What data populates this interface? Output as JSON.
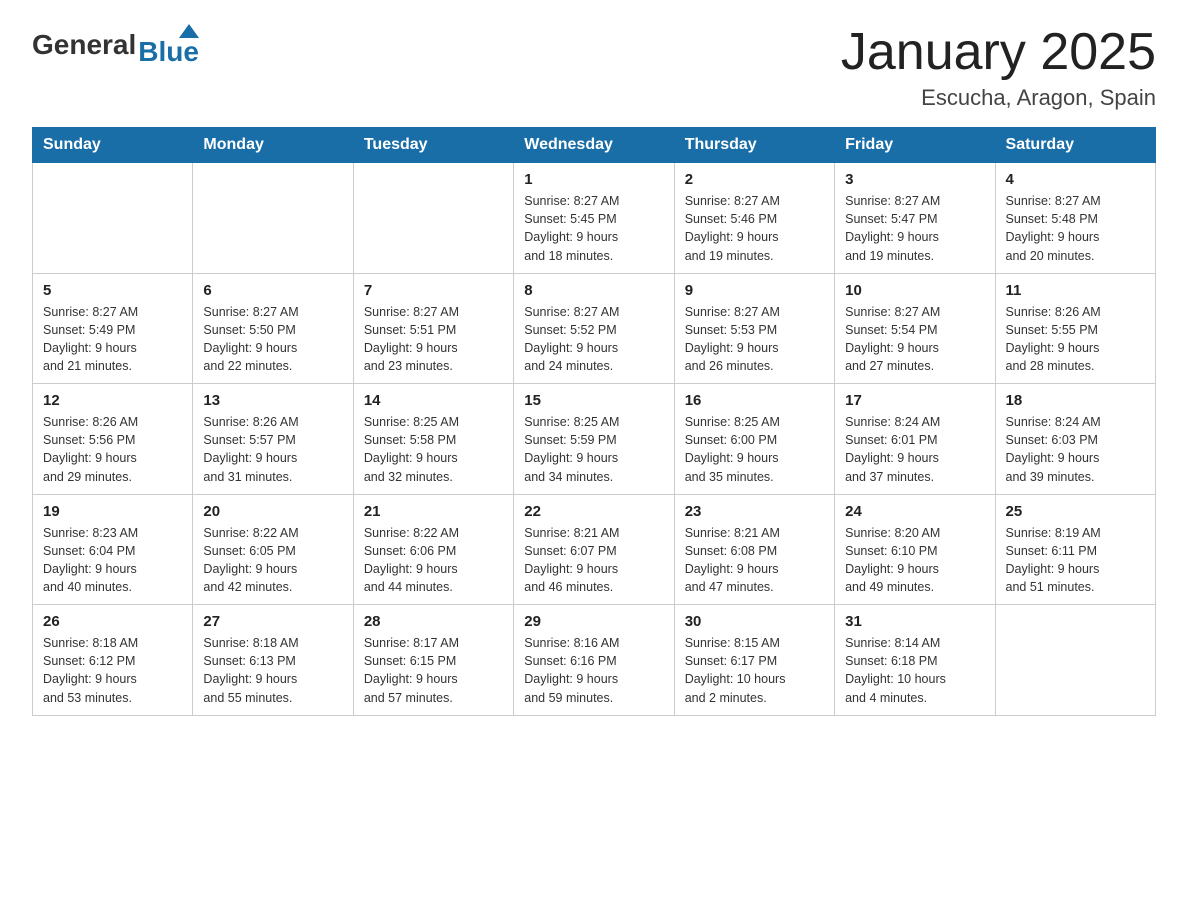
{
  "header": {
    "logo_general": "General",
    "logo_blue": "Blue",
    "month_title": "January 2025",
    "location": "Escucha, Aragon, Spain"
  },
  "days_of_week": [
    "Sunday",
    "Monday",
    "Tuesday",
    "Wednesday",
    "Thursday",
    "Friday",
    "Saturday"
  ],
  "weeks": [
    [
      {
        "day": "",
        "info": ""
      },
      {
        "day": "",
        "info": ""
      },
      {
        "day": "",
        "info": ""
      },
      {
        "day": "1",
        "info": "Sunrise: 8:27 AM\nSunset: 5:45 PM\nDaylight: 9 hours\nand 18 minutes."
      },
      {
        "day": "2",
        "info": "Sunrise: 8:27 AM\nSunset: 5:46 PM\nDaylight: 9 hours\nand 19 minutes."
      },
      {
        "day": "3",
        "info": "Sunrise: 8:27 AM\nSunset: 5:47 PM\nDaylight: 9 hours\nand 19 minutes."
      },
      {
        "day": "4",
        "info": "Sunrise: 8:27 AM\nSunset: 5:48 PM\nDaylight: 9 hours\nand 20 minutes."
      }
    ],
    [
      {
        "day": "5",
        "info": "Sunrise: 8:27 AM\nSunset: 5:49 PM\nDaylight: 9 hours\nand 21 minutes."
      },
      {
        "day": "6",
        "info": "Sunrise: 8:27 AM\nSunset: 5:50 PM\nDaylight: 9 hours\nand 22 minutes."
      },
      {
        "day": "7",
        "info": "Sunrise: 8:27 AM\nSunset: 5:51 PM\nDaylight: 9 hours\nand 23 minutes."
      },
      {
        "day": "8",
        "info": "Sunrise: 8:27 AM\nSunset: 5:52 PM\nDaylight: 9 hours\nand 24 minutes."
      },
      {
        "day": "9",
        "info": "Sunrise: 8:27 AM\nSunset: 5:53 PM\nDaylight: 9 hours\nand 26 minutes."
      },
      {
        "day": "10",
        "info": "Sunrise: 8:27 AM\nSunset: 5:54 PM\nDaylight: 9 hours\nand 27 minutes."
      },
      {
        "day": "11",
        "info": "Sunrise: 8:26 AM\nSunset: 5:55 PM\nDaylight: 9 hours\nand 28 minutes."
      }
    ],
    [
      {
        "day": "12",
        "info": "Sunrise: 8:26 AM\nSunset: 5:56 PM\nDaylight: 9 hours\nand 29 minutes."
      },
      {
        "day": "13",
        "info": "Sunrise: 8:26 AM\nSunset: 5:57 PM\nDaylight: 9 hours\nand 31 minutes."
      },
      {
        "day": "14",
        "info": "Sunrise: 8:25 AM\nSunset: 5:58 PM\nDaylight: 9 hours\nand 32 minutes."
      },
      {
        "day": "15",
        "info": "Sunrise: 8:25 AM\nSunset: 5:59 PM\nDaylight: 9 hours\nand 34 minutes."
      },
      {
        "day": "16",
        "info": "Sunrise: 8:25 AM\nSunset: 6:00 PM\nDaylight: 9 hours\nand 35 minutes."
      },
      {
        "day": "17",
        "info": "Sunrise: 8:24 AM\nSunset: 6:01 PM\nDaylight: 9 hours\nand 37 minutes."
      },
      {
        "day": "18",
        "info": "Sunrise: 8:24 AM\nSunset: 6:03 PM\nDaylight: 9 hours\nand 39 minutes."
      }
    ],
    [
      {
        "day": "19",
        "info": "Sunrise: 8:23 AM\nSunset: 6:04 PM\nDaylight: 9 hours\nand 40 minutes."
      },
      {
        "day": "20",
        "info": "Sunrise: 8:22 AM\nSunset: 6:05 PM\nDaylight: 9 hours\nand 42 minutes."
      },
      {
        "day": "21",
        "info": "Sunrise: 8:22 AM\nSunset: 6:06 PM\nDaylight: 9 hours\nand 44 minutes."
      },
      {
        "day": "22",
        "info": "Sunrise: 8:21 AM\nSunset: 6:07 PM\nDaylight: 9 hours\nand 46 minutes."
      },
      {
        "day": "23",
        "info": "Sunrise: 8:21 AM\nSunset: 6:08 PM\nDaylight: 9 hours\nand 47 minutes."
      },
      {
        "day": "24",
        "info": "Sunrise: 8:20 AM\nSunset: 6:10 PM\nDaylight: 9 hours\nand 49 minutes."
      },
      {
        "day": "25",
        "info": "Sunrise: 8:19 AM\nSunset: 6:11 PM\nDaylight: 9 hours\nand 51 minutes."
      }
    ],
    [
      {
        "day": "26",
        "info": "Sunrise: 8:18 AM\nSunset: 6:12 PM\nDaylight: 9 hours\nand 53 minutes."
      },
      {
        "day": "27",
        "info": "Sunrise: 8:18 AM\nSunset: 6:13 PM\nDaylight: 9 hours\nand 55 minutes."
      },
      {
        "day": "28",
        "info": "Sunrise: 8:17 AM\nSunset: 6:15 PM\nDaylight: 9 hours\nand 57 minutes."
      },
      {
        "day": "29",
        "info": "Sunrise: 8:16 AM\nSunset: 6:16 PM\nDaylight: 9 hours\nand 59 minutes."
      },
      {
        "day": "30",
        "info": "Sunrise: 8:15 AM\nSunset: 6:17 PM\nDaylight: 10 hours\nand 2 minutes."
      },
      {
        "day": "31",
        "info": "Sunrise: 8:14 AM\nSunset: 6:18 PM\nDaylight: 10 hours\nand 4 minutes."
      },
      {
        "day": "",
        "info": ""
      }
    ]
  ]
}
